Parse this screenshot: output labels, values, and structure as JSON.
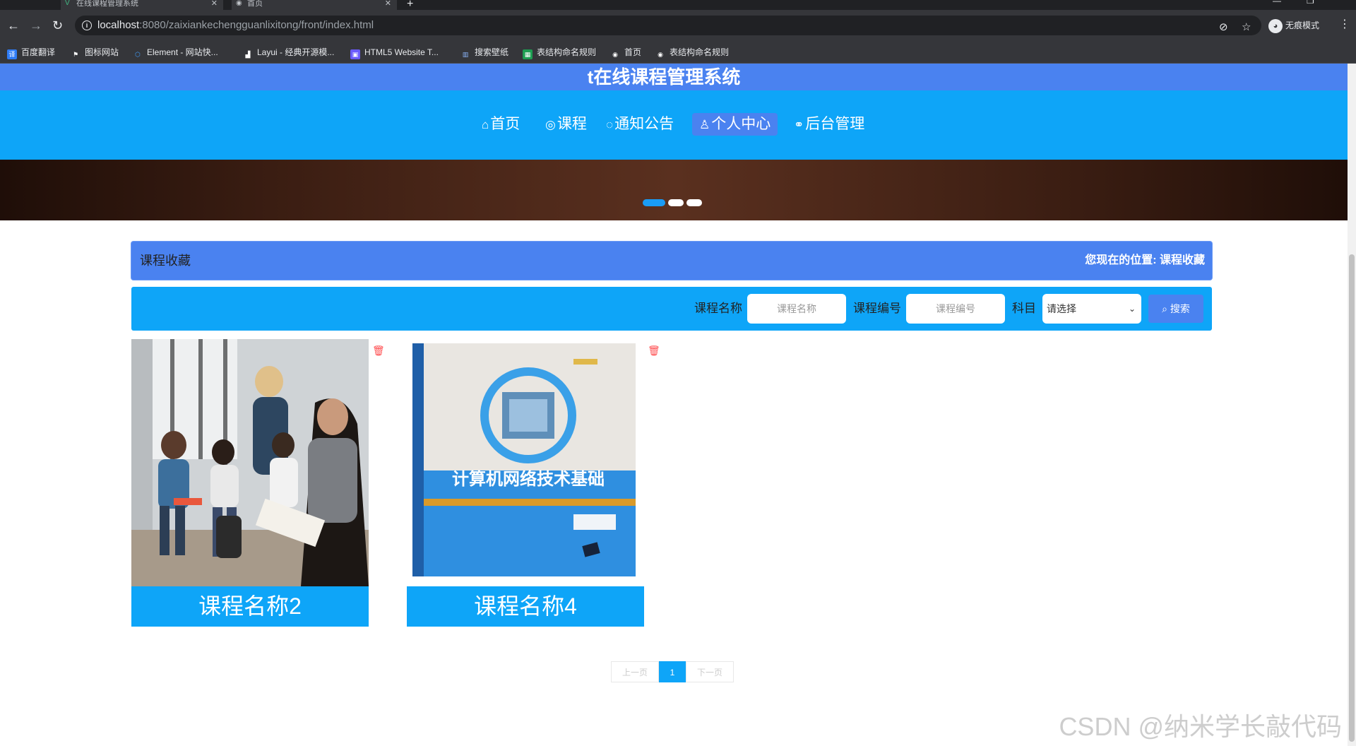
{
  "browser": {
    "tabs": [
      {
        "title": "在线课程管理系统",
        "icon": "vue-logo-icon"
      },
      {
        "title": "首页",
        "icon": "globe-icon"
      }
    ],
    "url_host": "localhost",
    "url_rest": ":8080/zaixiankechengguanlixitong/front/index.html",
    "profile_label": "无痕模式",
    "bookmarks": [
      {
        "label": "百度翻译",
        "color": "#2f7cf6"
      },
      {
        "label": "图标网站",
        "color": "#555555"
      },
      {
        "label": "Element - 网站快...",
        "color": "#409eff"
      },
      {
        "label": "Layui - 经典开源模...",
        "color": "#555555"
      },
      {
        "label": "HTML5 Website T...",
        "color": "#6b5bff"
      },
      {
        "label": "搜索壁纸",
        "color": "#4a6cf7"
      },
      {
        "label": "表结构命名规则",
        "color": "#1e9e52"
      },
      {
        "label": "首页",
        "color": "#555555"
      },
      {
        "label": "表结构命名规则",
        "color": "#555555"
      }
    ]
  },
  "site": {
    "title": "t在线课程管理系统",
    "nav": [
      {
        "icon": "home-icon",
        "glyph": "⌂",
        "label": "首页"
      },
      {
        "icon": "course-icon",
        "glyph": "◎",
        "label": "课程"
      },
      {
        "icon": "notice-icon",
        "glyph": "◌",
        "label": "通知公告"
      },
      {
        "icon": "user-icon",
        "glyph": "♙",
        "label": "个人中心",
        "active": true
      },
      {
        "icon": "link-icon",
        "glyph": "⚭",
        "label": "后台管理"
      }
    ]
  },
  "breadcrumb": {
    "title": "课程收藏",
    "location_prefix": "您现在的位置:",
    "location": "课程收藏"
  },
  "search": {
    "name_label": "课程名称",
    "name_placeholder": "课程名称",
    "code_label": "课程编号",
    "code_placeholder": "课程编号",
    "subject_label": "科目",
    "subject_value": "请选择",
    "button_label": "搜索"
  },
  "cards": [
    {
      "name": "课程名称2"
    },
    {
      "name": "课程名称4",
      "book_title": "计算机网络技术基础"
    }
  ],
  "pagination": {
    "prev": "上一页",
    "current": "1",
    "next": "下一页"
  },
  "watermark": "CSDN @纳米学长敲代码",
  "colors": {
    "header_blue": "#4a82f0",
    "nav_blue": "#0ea5f8",
    "delete_red": "#ff4d4f"
  }
}
